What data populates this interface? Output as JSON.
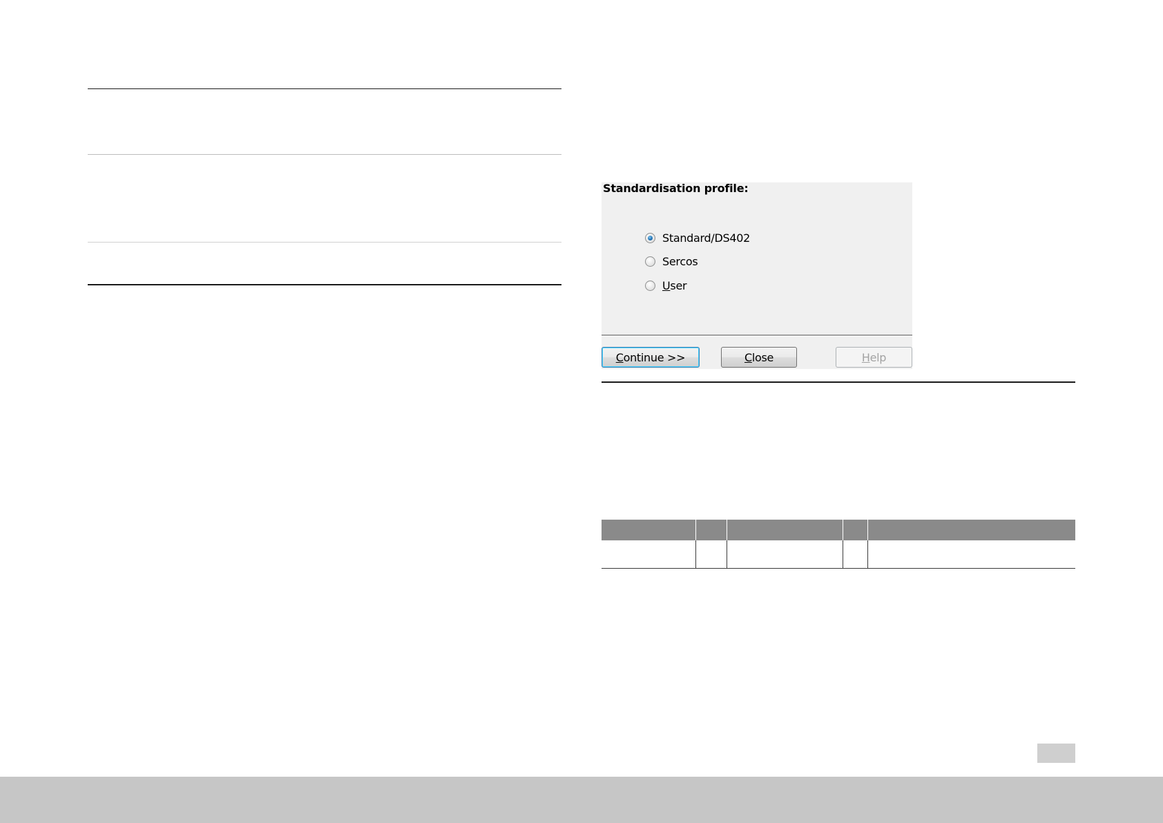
{
  "dialog": {
    "title": "Standardisation profile:",
    "options": [
      {
        "label": "Standard/DS402",
        "checked": true
      },
      {
        "label": "Sercos",
        "checked": false
      },
      {
        "label": "User",
        "checked": false
      }
    ],
    "buttons": {
      "continue": {
        "mnemonic": "C",
        "rest": "ontinue >>"
      },
      "close": {
        "mnemonic": "C",
        "rest": "lose"
      },
      "help": {
        "mnemonic": "H",
        "rest": "elp",
        "enabled": false
      }
    }
  },
  "colors": {
    "table_header": "#8a8a8a",
    "footer_bar": "#c6c6c6",
    "page_badge": "#cfcfcf",
    "dialog_bg": "#f0f0f0"
  },
  "icons": {
    "radio": "radio-button-icon"
  }
}
